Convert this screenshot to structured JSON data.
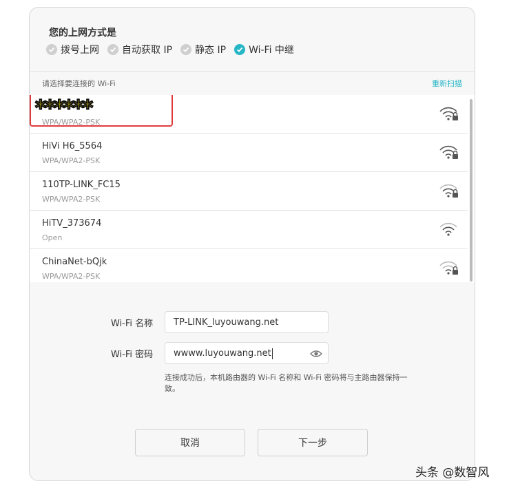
{
  "connection": {
    "title": "您的上网方式是",
    "modes": [
      {
        "label": "拨号上网",
        "selected": false
      },
      {
        "label": "自动获取 IP",
        "selected": false
      },
      {
        "label": "静态 IP",
        "selected": false
      },
      {
        "label": "Wi-Fi 中继",
        "selected": true
      }
    ]
  },
  "wifi_list": {
    "header": "请选择要连接的 Wi-Fi",
    "rescan_label": "重新扫描",
    "networks": [
      {
        "ssid": "******",
        "security": "WPA/WPA2-PSK",
        "locked": true,
        "masked": true
      },
      {
        "ssid": "HiVi H6_5564",
        "security": "WPA/WPA2-PSK",
        "locked": true
      },
      {
        "ssid": "110TP-LINK_FC15",
        "security": "WPA/WPA2-PSK",
        "locked": true
      },
      {
        "ssid": "HiTV_373674",
        "security": "Open",
        "locked": false
      },
      {
        "ssid": "ChinaNet-bQjk",
        "security": "WPA/WPA2-PSK",
        "locked": true
      }
    ]
  },
  "form": {
    "name_label": "Wi-Fi 名称",
    "name_value": "TP-LINK_luyouwang.net",
    "password_label": "Wi-Fi 密码",
    "password_value": "wwww.luyouwang.net",
    "hint": "连接成功后，本机路由器的 Wi-Fi 名称和 Wi-Fi 密码将与主路由器保持一致。"
  },
  "buttons": {
    "cancel": "取消",
    "next": "下一步"
  },
  "watermark": "头条 @数智风",
  "colors": {
    "accent": "#26b6c6",
    "highlight_border": "#e03a3a",
    "mask_text": "#ffe600"
  }
}
